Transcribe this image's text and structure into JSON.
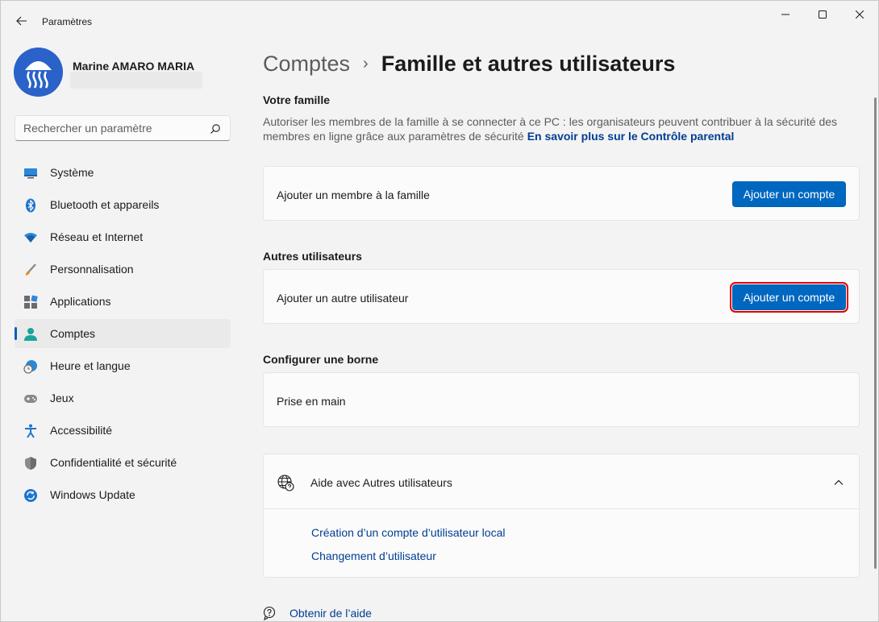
{
  "window": {
    "title": "Paramètres"
  },
  "profile": {
    "name": "Marine AMARO MARIA"
  },
  "search": {
    "placeholder": "Rechercher un paramètre"
  },
  "sidebar": {
    "items": [
      {
        "label": "Système",
        "icon": "monitor-icon"
      },
      {
        "label": "Bluetooth et appareils",
        "icon": "bluetooth-icon"
      },
      {
        "label": "Réseau et Internet",
        "icon": "wifi-icon"
      },
      {
        "label": "Personnalisation",
        "icon": "brush-icon"
      },
      {
        "label": "Applications",
        "icon": "apps-icon"
      },
      {
        "label": "Comptes",
        "icon": "person-icon",
        "active": true
      },
      {
        "label": "Heure et langue",
        "icon": "globe-clock-icon"
      },
      {
        "label": "Jeux",
        "icon": "gamepad-icon"
      },
      {
        "label": "Accessibilité",
        "icon": "accessibility-icon"
      },
      {
        "label": "Confidentialité et sécurité",
        "icon": "shield-icon"
      },
      {
        "label": "Windows Update",
        "icon": "update-icon"
      }
    ]
  },
  "breadcrumb": {
    "parent": "Comptes",
    "separator": "›",
    "current": "Famille et autres utilisateurs"
  },
  "family": {
    "title": "Votre famille",
    "description": "Autoriser les membres de la famille à se connecter à ce PC : les organisateurs peuvent contribuer à la sécurité des membres en ligne grâce aux paramètres de sécurité",
    "link": "En savoir plus sur le Contrôle parental",
    "card_label": "Ajouter un membre à la famille",
    "button": "Ajouter un compte"
  },
  "other_users": {
    "title": "Autres utilisateurs",
    "card_label": "Ajouter un autre utilisateur",
    "button": "Ajouter un compte"
  },
  "kiosk": {
    "title": "Configurer une borne",
    "card_label": "Prise en main"
  },
  "help": {
    "title": "Aide avec Autres utilisateurs",
    "links": [
      "Création d’un compte d’utilisateur local",
      "Changement d’utilisateur"
    ]
  },
  "footer": {
    "get_help": "Obtenir de l’aide"
  },
  "colors": {
    "accent": "#0067c0",
    "link": "#003e92",
    "highlight": "#e00000"
  }
}
